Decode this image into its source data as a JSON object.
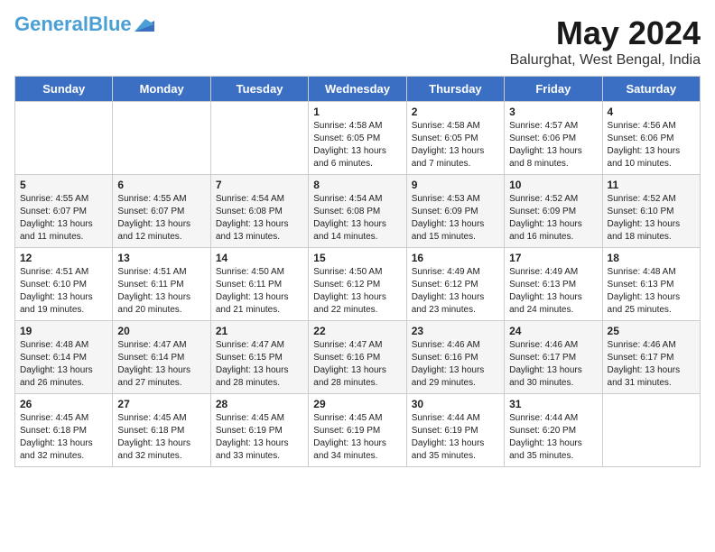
{
  "header": {
    "logo_general": "General",
    "logo_blue": "Blue",
    "main_title": "May 2024",
    "subtitle": "Balurghat, West Bengal, India"
  },
  "calendar": {
    "days_of_week": [
      "Sunday",
      "Monday",
      "Tuesday",
      "Wednesday",
      "Thursday",
      "Friday",
      "Saturday"
    ],
    "weeks": [
      [
        {
          "day": "",
          "info": ""
        },
        {
          "day": "",
          "info": ""
        },
        {
          "day": "",
          "info": ""
        },
        {
          "day": "1",
          "info": "Sunrise: 4:58 AM\nSunset: 6:05 PM\nDaylight: 13 hours\nand 6 minutes."
        },
        {
          "day": "2",
          "info": "Sunrise: 4:58 AM\nSunset: 6:05 PM\nDaylight: 13 hours\nand 7 minutes."
        },
        {
          "day": "3",
          "info": "Sunrise: 4:57 AM\nSunset: 6:06 PM\nDaylight: 13 hours\nand 8 minutes."
        },
        {
          "day": "4",
          "info": "Sunrise: 4:56 AM\nSunset: 6:06 PM\nDaylight: 13 hours\nand 10 minutes."
        }
      ],
      [
        {
          "day": "5",
          "info": "Sunrise: 4:55 AM\nSunset: 6:07 PM\nDaylight: 13 hours\nand 11 minutes."
        },
        {
          "day": "6",
          "info": "Sunrise: 4:55 AM\nSunset: 6:07 PM\nDaylight: 13 hours\nand 12 minutes."
        },
        {
          "day": "7",
          "info": "Sunrise: 4:54 AM\nSunset: 6:08 PM\nDaylight: 13 hours\nand 13 minutes."
        },
        {
          "day": "8",
          "info": "Sunrise: 4:54 AM\nSunset: 6:08 PM\nDaylight: 13 hours\nand 14 minutes."
        },
        {
          "day": "9",
          "info": "Sunrise: 4:53 AM\nSunset: 6:09 PM\nDaylight: 13 hours\nand 15 minutes."
        },
        {
          "day": "10",
          "info": "Sunrise: 4:52 AM\nSunset: 6:09 PM\nDaylight: 13 hours\nand 16 minutes."
        },
        {
          "day": "11",
          "info": "Sunrise: 4:52 AM\nSunset: 6:10 PM\nDaylight: 13 hours\nand 18 minutes."
        }
      ],
      [
        {
          "day": "12",
          "info": "Sunrise: 4:51 AM\nSunset: 6:10 PM\nDaylight: 13 hours\nand 19 minutes."
        },
        {
          "day": "13",
          "info": "Sunrise: 4:51 AM\nSunset: 6:11 PM\nDaylight: 13 hours\nand 20 minutes."
        },
        {
          "day": "14",
          "info": "Sunrise: 4:50 AM\nSunset: 6:11 PM\nDaylight: 13 hours\nand 21 minutes."
        },
        {
          "day": "15",
          "info": "Sunrise: 4:50 AM\nSunset: 6:12 PM\nDaylight: 13 hours\nand 22 minutes."
        },
        {
          "day": "16",
          "info": "Sunrise: 4:49 AM\nSunset: 6:12 PM\nDaylight: 13 hours\nand 23 minutes."
        },
        {
          "day": "17",
          "info": "Sunrise: 4:49 AM\nSunset: 6:13 PM\nDaylight: 13 hours\nand 24 minutes."
        },
        {
          "day": "18",
          "info": "Sunrise: 4:48 AM\nSunset: 6:13 PM\nDaylight: 13 hours\nand 25 minutes."
        }
      ],
      [
        {
          "day": "19",
          "info": "Sunrise: 4:48 AM\nSunset: 6:14 PM\nDaylight: 13 hours\nand 26 minutes."
        },
        {
          "day": "20",
          "info": "Sunrise: 4:47 AM\nSunset: 6:14 PM\nDaylight: 13 hours\nand 27 minutes."
        },
        {
          "day": "21",
          "info": "Sunrise: 4:47 AM\nSunset: 6:15 PM\nDaylight: 13 hours\nand 28 minutes."
        },
        {
          "day": "22",
          "info": "Sunrise: 4:47 AM\nSunset: 6:16 PM\nDaylight: 13 hours\nand 28 minutes."
        },
        {
          "day": "23",
          "info": "Sunrise: 4:46 AM\nSunset: 6:16 PM\nDaylight: 13 hours\nand 29 minutes."
        },
        {
          "day": "24",
          "info": "Sunrise: 4:46 AM\nSunset: 6:17 PM\nDaylight: 13 hours\nand 30 minutes."
        },
        {
          "day": "25",
          "info": "Sunrise: 4:46 AM\nSunset: 6:17 PM\nDaylight: 13 hours\nand 31 minutes."
        }
      ],
      [
        {
          "day": "26",
          "info": "Sunrise: 4:45 AM\nSunset: 6:18 PM\nDaylight: 13 hours\nand 32 minutes."
        },
        {
          "day": "27",
          "info": "Sunrise: 4:45 AM\nSunset: 6:18 PM\nDaylight: 13 hours\nand 32 minutes."
        },
        {
          "day": "28",
          "info": "Sunrise: 4:45 AM\nSunset: 6:19 PM\nDaylight: 13 hours\nand 33 minutes."
        },
        {
          "day": "29",
          "info": "Sunrise: 4:45 AM\nSunset: 6:19 PM\nDaylight: 13 hours\nand 34 minutes."
        },
        {
          "day": "30",
          "info": "Sunrise: 4:44 AM\nSunset: 6:19 PM\nDaylight: 13 hours\nand 35 minutes."
        },
        {
          "day": "31",
          "info": "Sunrise: 4:44 AM\nSunset: 6:20 PM\nDaylight: 13 hours\nand 35 minutes."
        },
        {
          "day": "",
          "info": ""
        }
      ]
    ]
  }
}
